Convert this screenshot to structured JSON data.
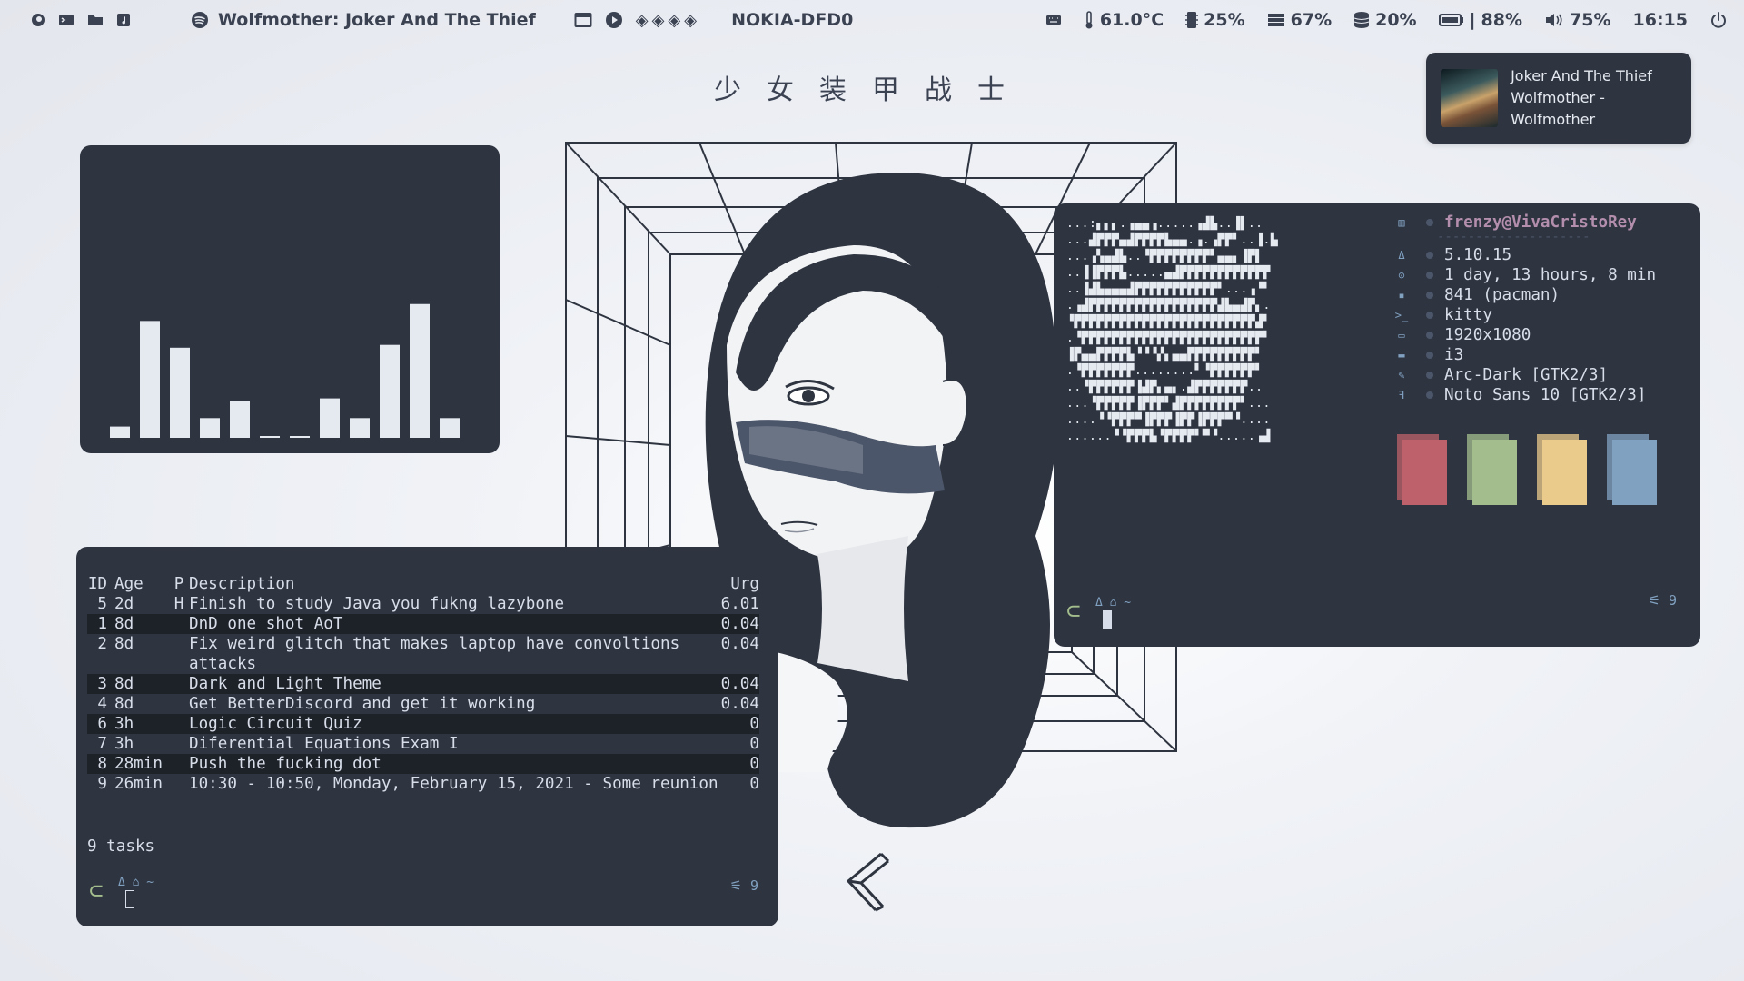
{
  "bar": {
    "left_icons": [
      "firefox-icon",
      "terminal-icon",
      "folder-icon",
      "music-icon"
    ],
    "app_icon": "spotify-icon",
    "window_title": "Wolfmother: Joker And The Thief",
    "window_icon": "window-icon",
    "play_icon": "play-icon",
    "workspaces": "◈◈◈◈",
    "network": "NOKIA-DFD0",
    "keyboard_icon": "keyboard-icon",
    "temperature": "61.0°C",
    "cpu": "25%",
    "memory": "67%",
    "disk": "20%",
    "battery_sep": "|",
    "battery": "88%",
    "volume": "75%",
    "time": "16:15",
    "power_icon": "power-icon"
  },
  "heading": "少女装甲战士",
  "notification": {
    "title": "Joker And The Thief",
    "subtitle": "Wolfmother - Wolfmother"
  },
  "visualizer": {
    "levels": [
      0.08,
      0.83,
      0.64,
      0.14,
      0.26,
      0.01,
      0.01,
      0.28,
      0.14,
      0.66,
      0.95,
      0.14
    ],
    "color": "#e5e9f0"
  },
  "tasks": {
    "headers": {
      "id": "ID",
      "age": "Age",
      "p": "P",
      "description": "Description",
      "urg": "Urg"
    },
    "rows": [
      {
        "id": "5",
        "age": "2d",
        "p": "H",
        "description": "Finish to study Java you fukng lazybone",
        "urg": "6.01"
      },
      {
        "id": "1",
        "age": "8d",
        "p": "",
        "description": "DnD one shot AoT",
        "urg": "0.04"
      },
      {
        "id": "2",
        "age": "8d",
        "p": "",
        "description": "Fix weird glitch that makes laptop have convoltions attacks",
        "urg": "0.04"
      },
      {
        "id": "3",
        "age": "8d",
        "p": "",
        "description": "Dark and Light Theme",
        "urg": "0.04"
      },
      {
        "id": "4",
        "age": "8d",
        "p": "",
        "description": "Get BetterDiscord and get it working",
        "urg": "0.04"
      },
      {
        "id": "6",
        "age": "3h",
        "p": "",
        "description": "Logic Circuit Quiz",
        "urg": "0"
      },
      {
        "id": "7",
        "age": "3h",
        "p": "",
        "description": "Diferential Equations Exam I",
        "urg": "0"
      },
      {
        "id": "8",
        "age": "28min",
        "p": "",
        "description": "Push the fucking dot",
        "urg": "0"
      },
      {
        "id": "9",
        "age": "26min",
        "p": "",
        "description": "10:30 - 10:50, Monday, February 15, 2021 - Some reunion",
        "urg": "0"
      }
    ],
    "summary": "9 tasks",
    "prompt_meta": "Δ ⌂ ~",
    "jobs": "⚟ 9"
  },
  "fetch": {
    "ascii": "...:▖▖▖.▗▄▄▗.....▗▟▙..▐▌..\n...▟▛▛▛▄▟▛▛▛▛▙▄▄.▗.▗▛▛▘..▐.▙\n...▗▚▄▟▙..▝▛▛▛▛▛▛▛▛▘▄▄▖▐▛▌\n..▐▐▛▛▛▙.....▄▟▛▛▛▛▛▛▛▛▛▛▛▛\n..▐▟▙▄▄▄▟▛▛▛▛▛▛▛▛▛▛▛▘...▗▝▘\n.▗▟▛▛▛▛▛▛▛▛▛▛▛▛▛▛▛▛▛▟▙▄▟▛▖.\n▝▛▛▛▛▛▛▛▛▛▛▛▛▛▛▛▛▛▛▛▛▛▛▛▛▟▘\n.▝▛▛▛▛▛▛▛▛▛▛▛▛▛▛▛▛▛▛▛▛▛▛▛▛▘\n▐▛▄▄▛▛▛▛▙▝▝▝▞▖▄▄▛▛▛▛▛▛▛▛▛▘\n.▝▛▛▛▛▛▛▛........▘▝▛▛▛▛▛▛▘\n..▝▛▛▛▛▛▛▐▟▛▖▄▖.▟▛▛▛▛▛▛▛..\n...▝▛▛▛▛▛▐▛▛▛▘▟▛▛▛▛▛▛▛▛▘...\n....▝▝▛▛▛▀▐▛▛▛▐▛▛▐▛▛▛▀▝....\n......▝▝▛▛▛▙▝▛▛▛▛▘▀▝.....▗▟",
    "user": "frenzy@VivaCristoRey",
    "separator": "--------------------",
    "rows": [
      {
        "icon": "Δ",
        "value": "5.10.15"
      },
      {
        "icon": "⊙",
        "value": "1 day, 13 hours, 8 min"
      },
      {
        "icon": "▪",
        "value": "841 (pacman)"
      },
      {
        "icon": ">_",
        "value": "kitty"
      },
      {
        "icon": "▭",
        "value": "1920x1080"
      },
      {
        "icon": "▬",
        "value": "i3"
      },
      {
        "icon": "✎",
        "value": "Arc-Dark [GTK2/3]"
      },
      {
        "icon": "ꟻ",
        "value": "Noto Sans 10 [GTK2/3]"
      }
    ],
    "user_icon": "▥",
    "palette": [
      "#bf616a",
      "#a3be8c",
      "#ebcb8b",
      "#81a1c1"
    ],
    "prompt_meta": "Δ ⌂ ~",
    "jobs": "⚟ 9"
  }
}
